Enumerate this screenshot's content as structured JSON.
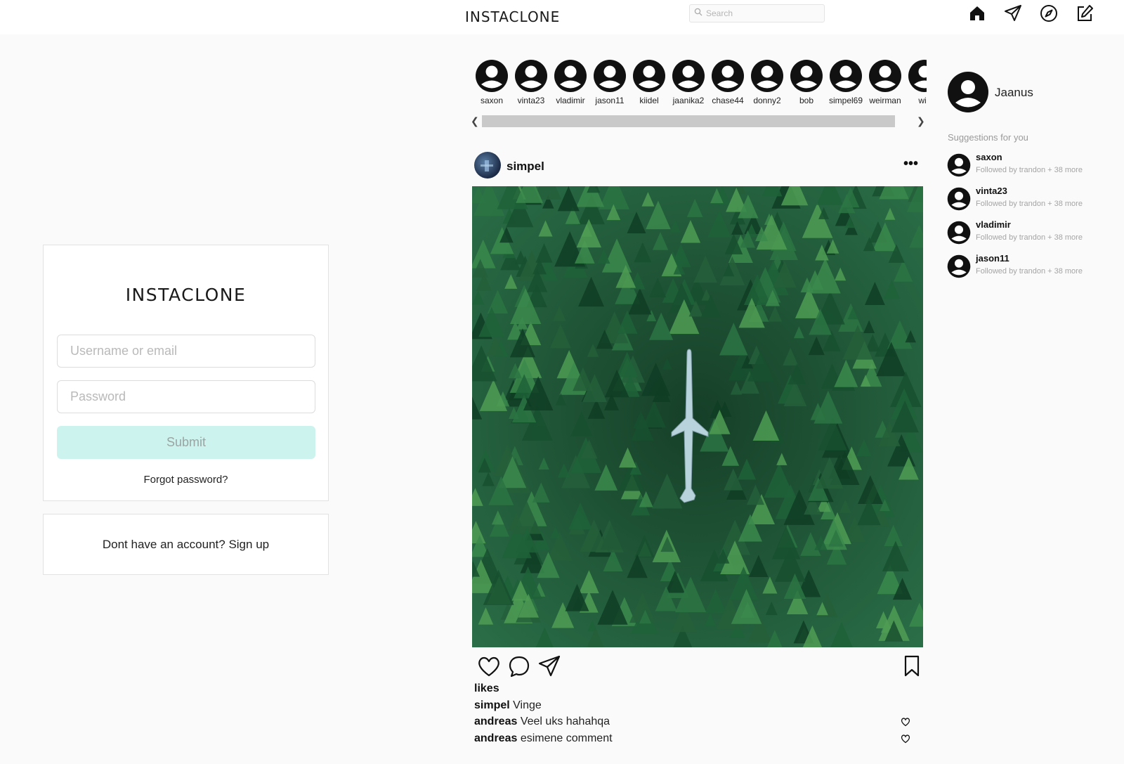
{
  "header": {
    "brand": "INSTACLONE",
    "search_placeholder": "Search",
    "icons": [
      "home-icon",
      "direct-send-icon",
      "explore-compass-icon",
      "new-post-icon"
    ]
  },
  "login": {
    "title": "INSTACLONE",
    "username_placeholder": "Username or email",
    "password_placeholder": "Password",
    "submit_label": "Submit",
    "forgot_label": "Forgot password?",
    "signup_label": "Dont have an account? Sign up"
  },
  "stories": [
    {
      "name": "saxon"
    },
    {
      "name": "vinta23"
    },
    {
      "name": "vladimir"
    },
    {
      "name": "jason11"
    },
    {
      "name": "kiidel"
    },
    {
      "name": "jaanika2"
    },
    {
      "name": "chase44"
    },
    {
      "name": "donny2"
    },
    {
      "name": "bob"
    },
    {
      "name": "simpel69"
    },
    {
      "name": "weirman"
    },
    {
      "name": "wis"
    }
  ],
  "post": {
    "username": "simpel",
    "more_label": "•••",
    "likes_label": "likes",
    "caption": {
      "user": "simpel",
      "text": "Vinge"
    },
    "comments": [
      {
        "user": "andreas",
        "text": "Veel uks hahahqa"
      },
      {
        "user": "andreas",
        "text": "esimene comment"
      }
    ]
  },
  "sidebar": {
    "current_user": "Jaanus",
    "suggestions_title": "Suggestions for you",
    "suggestions": [
      {
        "name": "saxon",
        "sub": "Followed by trandon + 38 more"
      },
      {
        "name": "vinta23",
        "sub": "Followed by trandon + 38 more"
      },
      {
        "name": "vladimir",
        "sub": "Followed by trandon + 38 more"
      },
      {
        "name": "jason11",
        "sub": "Followed by trandon + 38 more"
      }
    ]
  },
  "colors": {
    "background": "#fafafa",
    "submit_bg": "#cdf3ee",
    "forest": "#1f5a3a"
  }
}
